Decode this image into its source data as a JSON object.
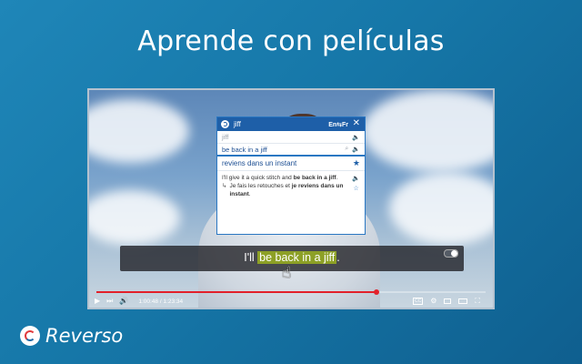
{
  "headline": "Aprende con películas",
  "popup": {
    "query": "jiff",
    "lang_pair": "En⇆Fr",
    "rows": [
      {
        "text": "jiff"
      },
      {
        "text": "be back in a jiff"
      }
    ],
    "translation": "reviens dans un instant",
    "example": {
      "source_pre": "I'll give it a quick stitch and ",
      "source_hl": "be back in a jiff",
      "source_post": ".",
      "target_pre": "Je fais les retouches et ",
      "target_hl": "je reviens dans un instant",
      "target_post": "."
    }
  },
  "subtitle": {
    "pre": "I'll ",
    "highlight": "be back in a jiff",
    "post": "."
  },
  "player": {
    "time": "1:00:48 / 1:23:34",
    "progress_fraction": 0.72
  },
  "brand": {
    "name": "Reverso"
  },
  "colors": {
    "background": "#1677a8",
    "popup_header": "#1e5fa8",
    "subtitle_highlight": "#8da026",
    "progress": "#e2202a"
  },
  "icons": [
    "close-icon",
    "speaker-icon",
    "search-icon",
    "star-icon",
    "play-icon",
    "next-icon",
    "volume-icon",
    "cc-icon",
    "gear-icon",
    "miniplayer-icon",
    "theater-icon",
    "fullscreen-icon",
    "hand-cursor-icon"
  ]
}
